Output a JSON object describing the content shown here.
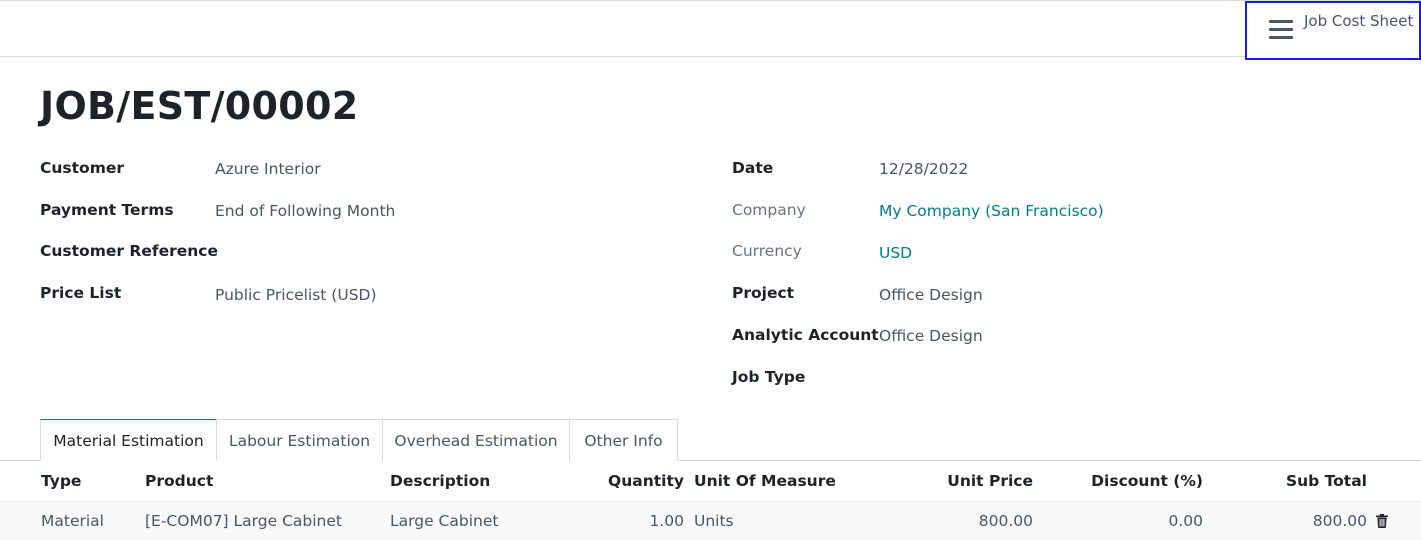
{
  "smart_button": {
    "label": "Job Cost Sheet",
    "icon": "hamburger-icon"
  },
  "record": {
    "title": "JOB/EST/00002"
  },
  "left_fields": [
    {
      "label": "Customer",
      "value": "Azure Interior"
    },
    {
      "label": "Payment Terms",
      "value": "End of Following Month"
    },
    {
      "label": "Customer Reference",
      "value": ""
    },
    {
      "label": "Price List",
      "value": "Public Pricelist (USD)"
    }
  ],
  "right_fields": [
    {
      "label": "Date",
      "value": "12/28/2022"
    },
    {
      "label": "Company",
      "value": "My Company (San Francisco)"
    },
    {
      "label": "Currency",
      "value": "USD"
    },
    {
      "label": "Project",
      "value": "Office Design"
    },
    {
      "label": "Analytic Account",
      "value": "Office Design"
    },
    {
      "label": "Job Type",
      "value": ""
    }
  ],
  "tabs": [
    {
      "label": "Material Estimation",
      "active": true
    },
    {
      "label": "Labour Estimation",
      "active": false
    },
    {
      "label": "Overhead Estimation",
      "active": false
    },
    {
      "label": "Other Info",
      "active": false
    }
  ],
  "table": {
    "headers": [
      "Type",
      "Product",
      "Description",
      "Quantity",
      "Unit Of Measure",
      "Unit Price",
      "Discount (%)",
      "Sub Total"
    ],
    "rows": [
      {
        "type": "Material",
        "product": "[E-COM07] Large Cabinet",
        "description": "Large Cabinet",
        "quantity": "1.00",
        "uom": "Units",
        "unit_price": "800.00",
        "discount": "0.00",
        "subtotal": "800.00"
      }
    ]
  },
  "colors": {
    "link": "#017e84",
    "accent_border": "#1a1ae0",
    "tab_active_top": "#9b3a66"
  }
}
